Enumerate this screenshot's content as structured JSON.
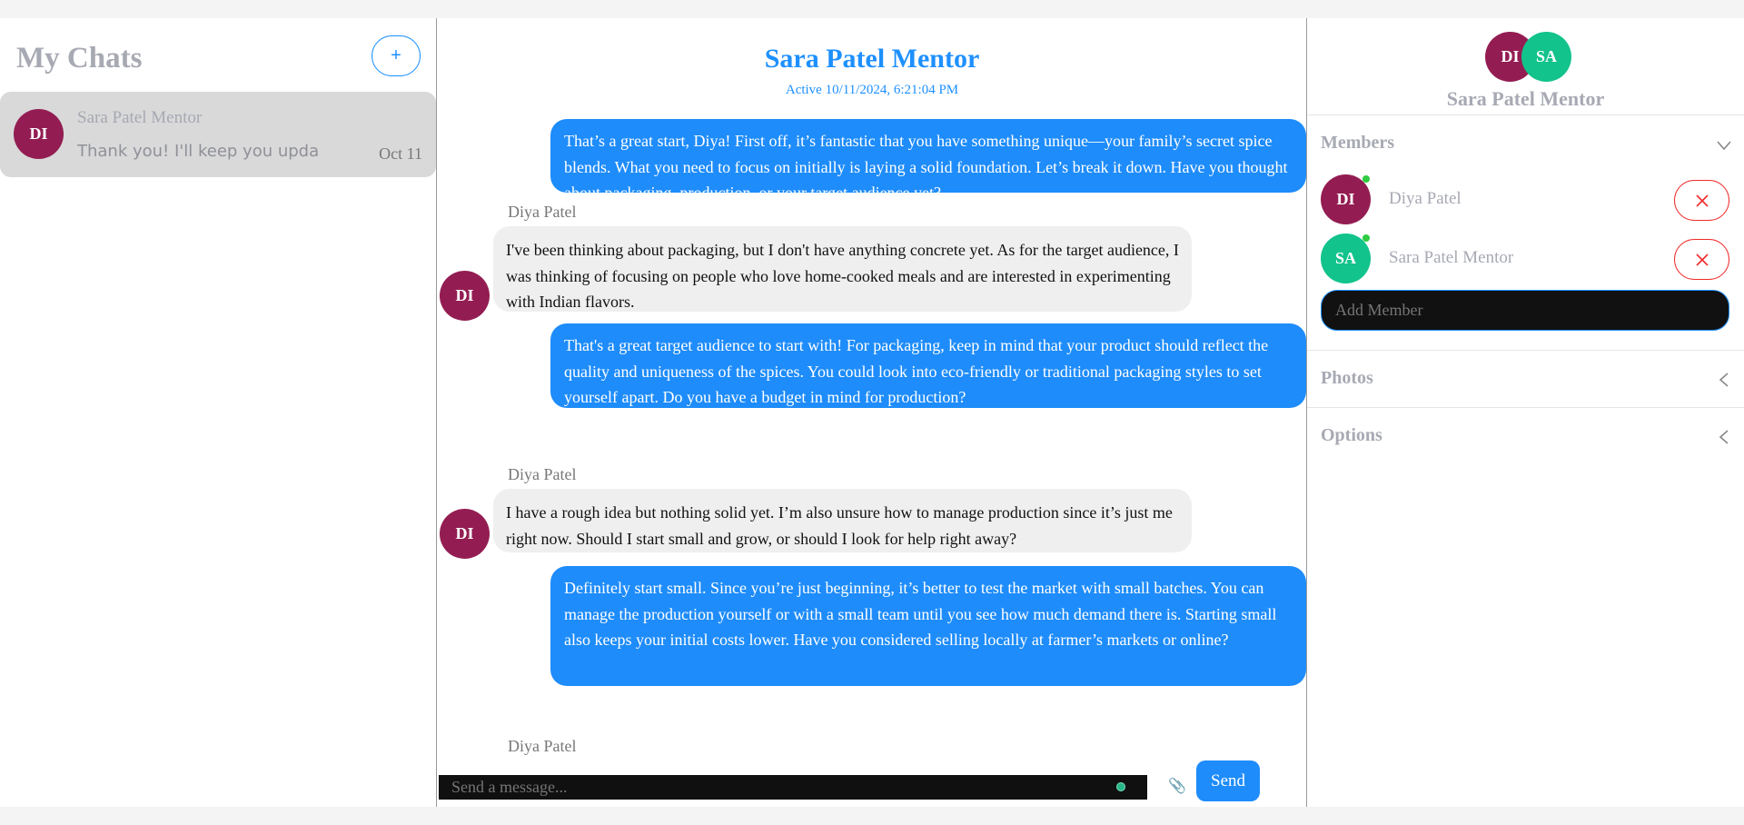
{
  "sidebar": {
    "title": "My Chats",
    "new_chat_label": "+",
    "chats": [
      {
        "initials": "DI",
        "name": "Sara Patel Mentor",
        "preview": "Thank you! I'll keep you upda",
        "date": "Oct 11"
      }
    ]
  },
  "chat": {
    "title": "Sara Patel Mentor",
    "status": "Active 10/11/2024, 6:21:04 PM",
    "messages": [
      {
        "direction": "out",
        "text": "That’s a great start, Diya! First off, it’s fantastic that you have something unique—your family’s secret spice blends. What you need to focus on initially is laying a solid foundation. Let’s break it down. Have you thought about packaging, production, or your target audience yet?"
      },
      {
        "direction": "in",
        "sender": "Diya Patel",
        "initials": "DI",
        "text": "I've been thinking about packaging, but I don't have anything concrete yet. As for the target audience, I was thinking of focusing on people who love home-cooked meals and are interested in experimenting with Indian flavors."
      },
      {
        "direction": "out",
        "text": "That's a great target audience to start with! For packaging, keep in mind that your product should reflect the quality and uniqueness of the spices. You could look into eco-friendly or traditional packaging styles to set yourself apart. Do you have a budget in mind for production?"
      },
      {
        "direction": "in",
        "sender": "Diya Patel",
        "initials": "DI",
        "text": "I have a rough idea but nothing solid yet. I’m also unsure how to manage production since it’s just me right now. Should I start small and grow, or should I look for help right away?"
      },
      {
        "direction": "out",
        "text": "Definitely start small. Since you’re just beginning, it’s better to test the market with small batches. You can manage the production yourself or with a small team until you see how much demand there is. Starting small also keeps your initial costs lower. Have you considered selling locally at farmer’s markets or online?"
      },
      {
        "direction": "in",
        "sender": "Diya Patel"
      }
    ],
    "composer": {
      "placeholder": "Send a message...",
      "attach_icon": "paperclip-icon",
      "send_label": "Send"
    }
  },
  "details": {
    "avatars": [
      "DI",
      "SA"
    ],
    "name": "Sara Patel Mentor",
    "members_title": "Members",
    "members": [
      {
        "initials": "DI",
        "name": "Diya Patel",
        "color": "#931d52"
      },
      {
        "initials": "SA",
        "name": "Sara Patel Mentor",
        "color": "#12c38b"
      }
    ],
    "add_member_placeholder": "Add Member",
    "photos_title": "Photos",
    "options_title": "Options"
  },
  "colors": {
    "accent": "#1e8cfa",
    "danger": "#f02b2b",
    "online": "#2ecc40",
    "avatar_di": "#931d52",
    "avatar_sa": "#12c38b"
  }
}
